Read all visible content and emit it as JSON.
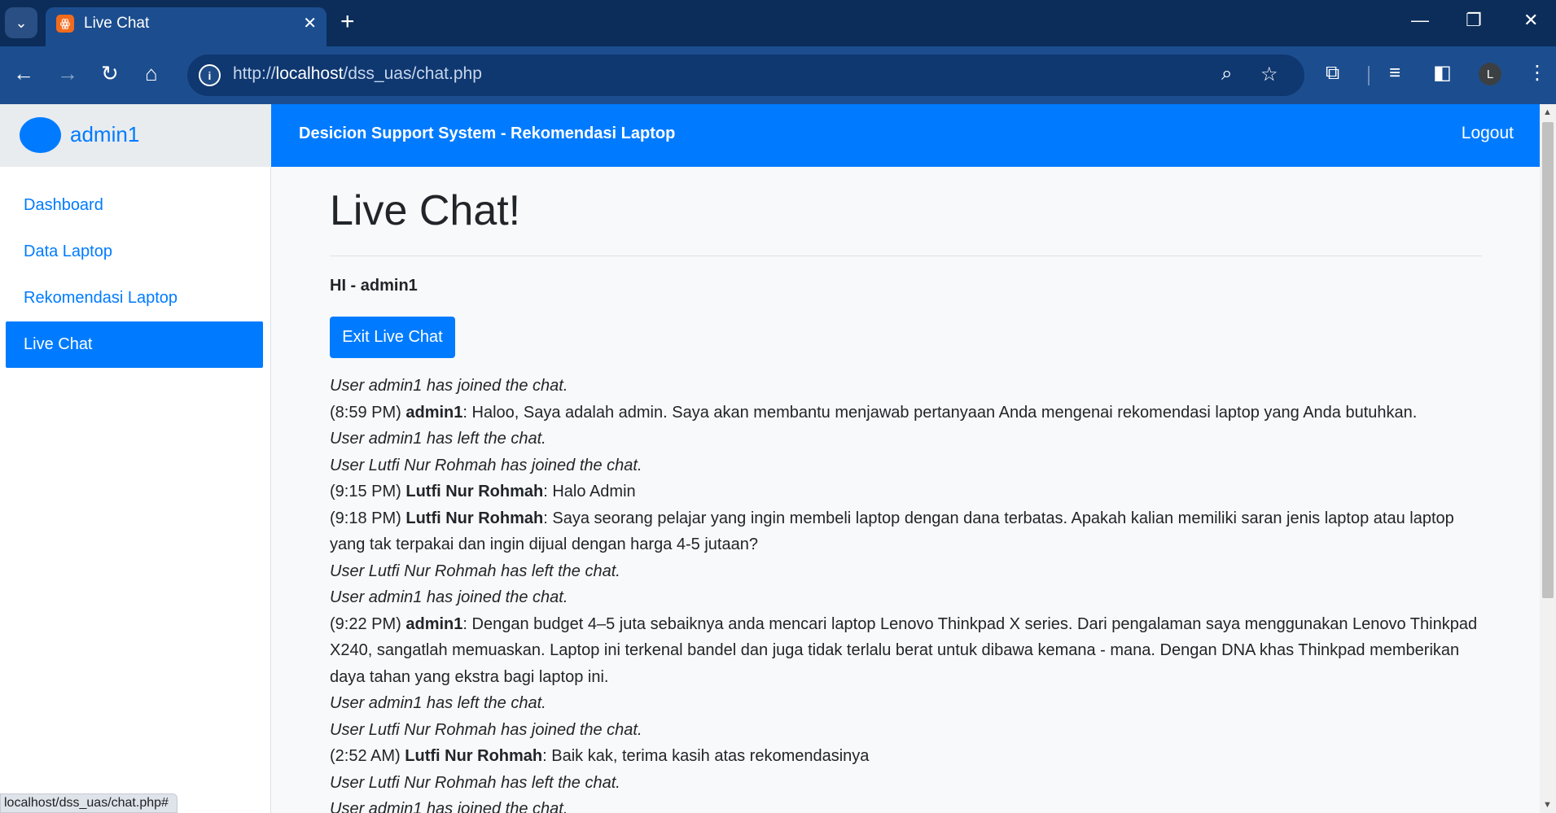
{
  "browser": {
    "tab_title": "Live Chat",
    "favicon_glyph": "ꙮ",
    "close_glyph": "✕",
    "newtab_glyph": "+",
    "url_host": "localhost",
    "url_prefix": "http://",
    "url_path": "/dss_uas/chat.php",
    "profile_initial": "L",
    "status_url": "localhost/dss_uas/chat.php#"
  },
  "sidebar": {
    "user_name": "admin1",
    "items": [
      {
        "label": "Dashboard"
      },
      {
        "label": "Data Laptop"
      },
      {
        "label": "Rekomendasi Laptop"
      },
      {
        "label": "Live Chat"
      }
    ]
  },
  "header": {
    "brand": "Desicion Support System - Rekomendasi Laptop",
    "logout": "Logout"
  },
  "main": {
    "title": "Live Chat!",
    "greeting": "HI - admin1",
    "exit_button": "Exit Live Chat"
  },
  "chat": [
    {
      "type": "system",
      "text": "User admin1 has joined the chat."
    },
    {
      "type": "message",
      "time": "(8:59 PM)",
      "sender": "admin1",
      "text": ": Haloo, Saya adalah admin. Saya akan membantu menjawab pertanyaan Anda mengenai rekomendasi laptop yang Anda butuhkan."
    },
    {
      "type": "system",
      "text": "User admin1 has left the chat."
    },
    {
      "type": "system",
      "text": "User Lutfi Nur Rohmah has joined the chat."
    },
    {
      "type": "message",
      "time": "(9:15 PM)",
      "sender": "Lutfi Nur Rohmah",
      "text": ": Halo Admin"
    },
    {
      "type": "message",
      "time": "(9:18 PM)",
      "sender": "Lutfi Nur Rohmah",
      "text": ": Saya seorang pelajar yang ingin membeli laptop dengan dana terbatas. Apakah kalian memiliki saran jenis laptop atau laptop yang tak terpakai dan ingin dijual dengan harga 4-5 jutaan?"
    },
    {
      "type": "system",
      "text": "User Lutfi Nur Rohmah has left the chat."
    },
    {
      "type": "system",
      "text": "User admin1 has joined the chat."
    },
    {
      "type": "message",
      "time": "(9:22 PM)",
      "sender": "admin1",
      "text": ": Dengan budget 4–5 juta sebaiknya anda mencari laptop Lenovo Thinkpad X series. Dari pengalaman saya menggunakan Lenovo Thinkpad X240, sangatlah memuaskan. Laptop ini terkenal bandel dan juga tidak terlalu berat untuk dibawa kemana - mana. Dengan DNA khas Thinkpad memberikan daya tahan yang ekstra bagi laptop ini."
    },
    {
      "type": "system",
      "text": "User admin1 has left the chat."
    },
    {
      "type": "system",
      "text": "User Lutfi Nur Rohmah has joined the chat."
    },
    {
      "type": "message",
      "time": "(2:52 AM)",
      "sender": "Lutfi Nur Rohmah",
      "text": ": Baik kak, terima kasih atas rekomendasinya"
    },
    {
      "type": "system",
      "text": "User Lutfi Nur Rohmah has left the chat."
    },
    {
      "type": "system",
      "text": "User admin1 has joined the chat."
    }
  ]
}
